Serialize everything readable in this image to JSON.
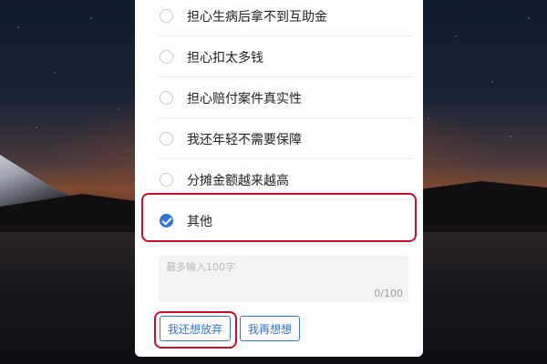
{
  "options": [
    {
      "label": "担心生病后拿不到互助金",
      "checked": false
    },
    {
      "label": "担心扣太多钱",
      "checked": false
    },
    {
      "label": "担心赔付案件真实性",
      "checked": false
    },
    {
      "label": "我还年轻不需要保障",
      "checked": false
    },
    {
      "label": "分摊金额越来越高",
      "checked": false
    },
    {
      "label": "其他",
      "checked": true
    }
  ],
  "feedback": {
    "placeholder": "最多输入100字",
    "value": "",
    "counter": "0/100"
  },
  "buttons": {
    "give_up": "我还想放弃",
    "think_again": "我再想想"
  },
  "colors": {
    "accent": "#2f74db",
    "highlight": "#c8102e"
  }
}
